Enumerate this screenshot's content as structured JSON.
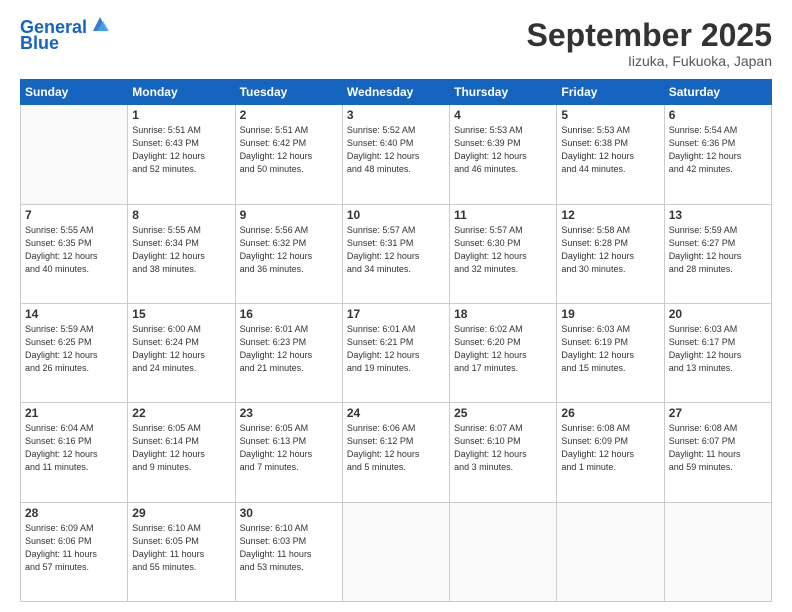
{
  "header": {
    "logo_line1": "General",
    "logo_line2": "Blue",
    "title": "September 2025",
    "subtitle": "Iizuka, Fukuoka, Japan"
  },
  "days_of_week": [
    "Sunday",
    "Monday",
    "Tuesday",
    "Wednesday",
    "Thursday",
    "Friday",
    "Saturday"
  ],
  "weeks": [
    [
      {
        "day": "",
        "info": ""
      },
      {
        "day": "1",
        "info": "Sunrise: 5:51 AM\nSunset: 6:43 PM\nDaylight: 12 hours\nand 52 minutes."
      },
      {
        "day": "2",
        "info": "Sunrise: 5:51 AM\nSunset: 6:42 PM\nDaylight: 12 hours\nand 50 minutes."
      },
      {
        "day": "3",
        "info": "Sunrise: 5:52 AM\nSunset: 6:40 PM\nDaylight: 12 hours\nand 48 minutes."
      },
      {
        "day": "4",
        "info": "Sunrise: 5:53 AM\nSunset: 6:39 PM\nDaylight: 12 hours\nand 46 minutes."
      },
      {
        "day": "5",
        "info": "Sunrise: 5:53 AM\nSunset: 6:38 PM\nDaylight: 12 hours\nand 44 minutes."
      },
      {
        "day": "6",
        "info": "Sunrise: 5:54 AM\nSunset: 6:36 PM\nDaylight: 12 hours\nand 42 minutes."
      }
    ],
    [
      {
        "day": "7",
        "info": "Sunrise: 5:55 AM\nSunset: 6:35 PM\nDaylight: 12 hours\nand 40 minutes."
      },
      {
        "day": "8",
        "info": "Sunrise: 5:55 AM\nSunset: 6:34 PM\nDaylight: 12 hours\nand 38 minutes."
      },
      {
        "day": "9",
        "info": "Sunrise: 5:56 AM\nSunset: 6:32 PM\nDaylight: 12 hours\nand 36 minutes."
      },
      {
        "day": "10",
        "info": "Sunrise: 5:57 AM\nSunset: 6:31 PM\nDaylight: 12 hours\nand 34 minutes."
      },
      {
        "day": "11",
        "info": "Sunrise: 5:57 AM\nSunset: 6:30 PM\nDaylight: 12 hours\nand 32 minutes."
      },
      {
        "day": "12",
        "info": "Sunrise: 5:58 AM\nSunset: 6:28 PM\nDaylight: 12 hours\nand 30 minutes."
      },
      {
        "day": "13",
        "info": "Sunrise: 5:59 AM\nSunset: 6:27 PM\nDaylight: 12 hours\nand 28 minutes."
      }
    ],
    [
      {
        "day": "14",
        "info": "Sunrise: 5:59 AM\nSunset: 6:25 PM\nDaylight: 12 hours\nand 26 minutes."
      },
      {
        "day": "15",
        "info": "Sunrise: 6:00 AM\nSunset: 6:24 PM\nDaylight: 12 hours\nand 24 minutes."
      },
      {
        "day": "16",
        "info": "Sunrise: 6:01 AM\nSunset: 6:23 PM\nDaylight: 12 hours\nand 21 minutes."
      },
      {
        "day": "17",
        "info": "Sunrise: 6:01 AM\nSunset: 6:21 PM\nDaylight: 12 hours\nand 19 minutes."
      },
      {
        "day": "18",
        "info": "Sunrise: 6:02 AM\nSunset: 6:20 PM\nDaylight: 12 hours\nand 17 minutes."
      },
      {
        "day": "19",
        "info": "Sunrise: 6:03 AM\nSunset: 6:19 PM\nDaylight: 12 hours\nand 15 minutes."
      },
      {
        "day": "20",
        "info": "Sunrise: 6:03 AM\nSunset: 6:17 PM\nDaylight: 12 hours\nand 13 minutes."
      }
    ],
    [
      {
        "day": "21",
        "info": "Sunrise: 6:04 AM\nSunset: 6:16 PM\nDaylight: 12 hours\nand 11 minutes."
      },
      {
        "day": "22",
        "info": "Sunrise: 6:05 AM\nSunset: 6:14 PM\nDaylight: 12 hours\nand 9 minutes."
      },
      {
        "day": "23",
        "info": "Sunrise: 6:05 AM\nSunset: 6:13 PM\nDaylight: 12 hours\nand 7 minutes."
      },
      {
        "day": "24",
        "info": "Sunrise: 6:06 AM\nSunset: 6:12 PM\nDaylight: 12 hours\nand 5 minutes."
      },
      {
        "day": "25",
        "info": "Sunrise: 6:07 AM\nSunset: 6:10 PM\nDaylight: 12 hours\nand 3 minutes."
      },
      {
        "day": "26",
        "info": "Sunrise: 6:08 AM\nSunset: 6:09 PM\nDaylight: 12 hours\nand 1 minute."
      },
      {
        "day": "27",
        "info": "Sunrise: 6:08 AM\nSunset: 6:07 PM\nDaylight: 11 hours\nand 59 minutes."
      }
    ],
    [
      {
        "day": "28",
        "info": "Sunrise: 6:09 AM\nSunset: 6:06 PM\nDaylight: 11 hours\nand 57 minutes."
      },
      {
        "day": "29",
        "info": "Sunrise: 6:10 AM\nSunset: 6:05 PM\nDaylight: 11 hours\nand 55 minutes."
      },
      {
        "day": "30",
        "info": "Sunrise: 6:10 AM\nSunset: 6:03 PM\nDaylight: 11 hours\nand 53 minutes."
      },
      {
        "day": "",
        "info": ""
      },
      {
        "day": "",
        "info": ""
      },
      {
        "day": "",
        "info": ""
      },
      {
        "day": "",
        "info": ""
      }
    ]
  ]
}
